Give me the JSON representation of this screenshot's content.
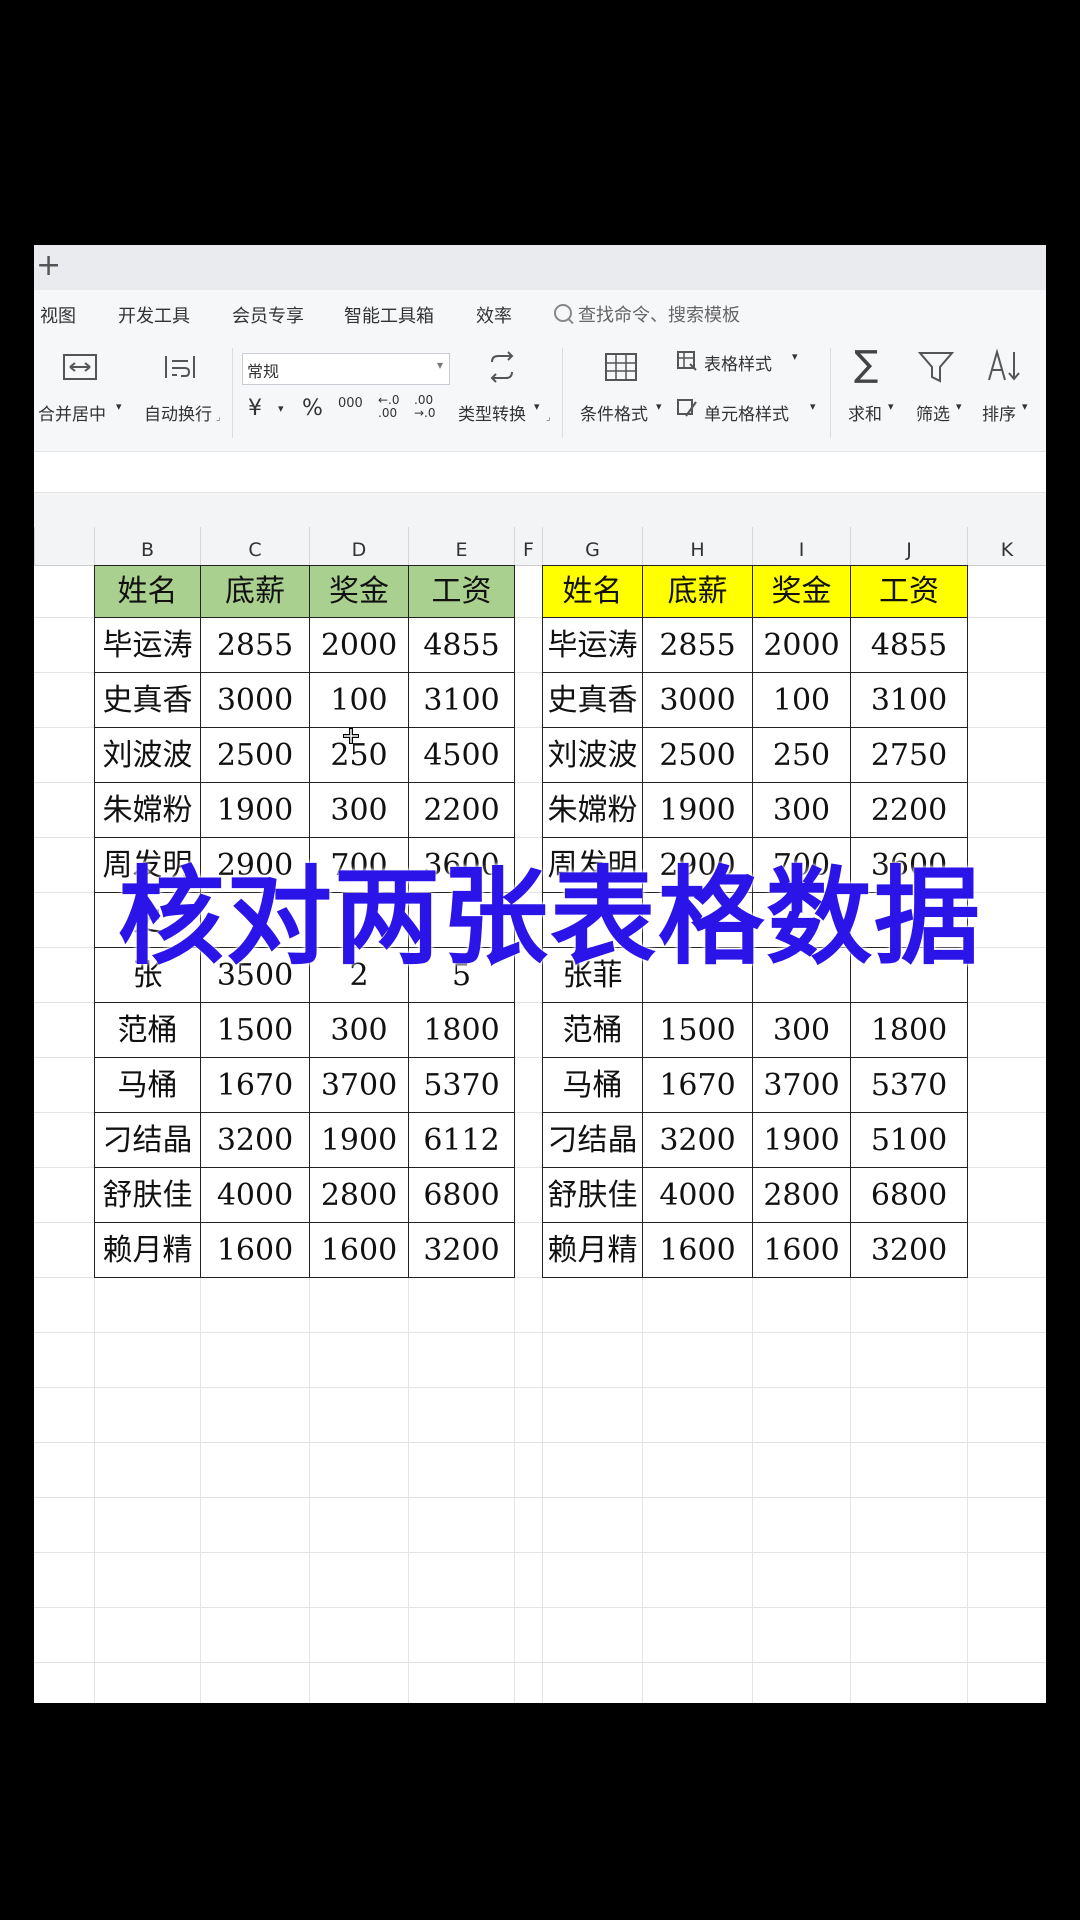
{
  "titlebar": {
    "new_tab": "+"
  },
  "menu": {
    "items": [
      "视图",
      "开发工具",
      "会员专享",
      "智能工具箱",
      "效率"
    ],
    "search_placeholder": "查找命令、搜索模板"
  },
  "ribbon": {
    "merge_center": "合并居中",
    "auto_wrap": "自动换行",
    "number_format": "常规",
    "currency": "¥",
    "percent": "%",
    "thousands": "000",
    "inc_decimal": "←.0 .00",
    "dec_decimal": ".00 →.0",
    "type_convert": "类型转换",
    "conditional_format": "条件格式",
    "table_style": "表格样式",
    "cell_style": "单元格样式",
    "sum": "求和",
    "filter": "筛选",
    "sort": "排序"
  },
  "columns": [
    "B",
    "C",
    "D",
    "E",
    "F",
    "G",
    "H",
    "I",
    "J",
    "K"
  ],
  "table_left": {
    "headers": [
      "姓名",
      "底薪",
      "奖金",
      "工资"
    ],
    "rows": [
      [
        "毕运涛",
        "2855",
        "2000",
        "4855"
      ],
      [
        "史真香",
        "3000",
        "100",
        "3100"
      ],
      [
        "刘波波",
        "2500",
        "250",
        "4500"
      ],
      [
        "朱嫦粉",
        "1900",
        "300",
        "2200"
      ],
      [
        "周发明",
        "2900",
        "700",
        "3600"
      ],
      [
        "史",
        "",
        "",
        ""
      ],
      [
        "张",
        "3500",
        "2",
        "5"
      ],
      [
        "范桶",
        "1500",
        "300",
        "1800"
      ],
      [
        "马桶",
        "1670",
        "3700",
        "5370"
      ],
      [
        "刁结晶",
        "3200",
        "1900",
        "6112"
      ],
      [
        "舒肤佳",
        "4000",
        "2800",
        "6800"
      ],
      [
        "赖月精",
        "1600",
        "1600",
        "3200"
      ]
    ]
  },
  "table_right": {
    "headers": [
      "姓名",
      "底薪",
      "奖金",
      "工资"
    ],
    "rows": [
      [
        "毕运涛",
        "2855",
        "2000",
        "4855"
      ],
      [
        "史真香",
        "3000",
        "100",
        "3100"
      ],
      [
        "刘波波",
        "2500",
        "250",
        "2750"
      ],
      [
        "朱嫦粉",
        "1900",
        "300",
        "2200"
      ],
      [
        "周发明",
        "2900",
        "700",
        "3600"
      ],
      [
        "",
        "",
        "",
        ""
      ],
      [
        "张菲",
        "",
        "",
        ""
      ],
      [
        "范桶",
        "1500",
        "300",
        "1800"
      ],
      [
        "马桶",
        "1670",
        "3700",
        "5370"
      ],
      [
        "刁结晶",
        "3200",
        "1900",
        "5100"
      ],
      [
        "舒肤佳",
        "4000",
        "2800",
        "6800"
      ],
      [
        "赖月精",
        "1600",
        "1600",
        "3200"
      ]
    ]
  },
  "overlay_title": "核对两张表格数据"
}
